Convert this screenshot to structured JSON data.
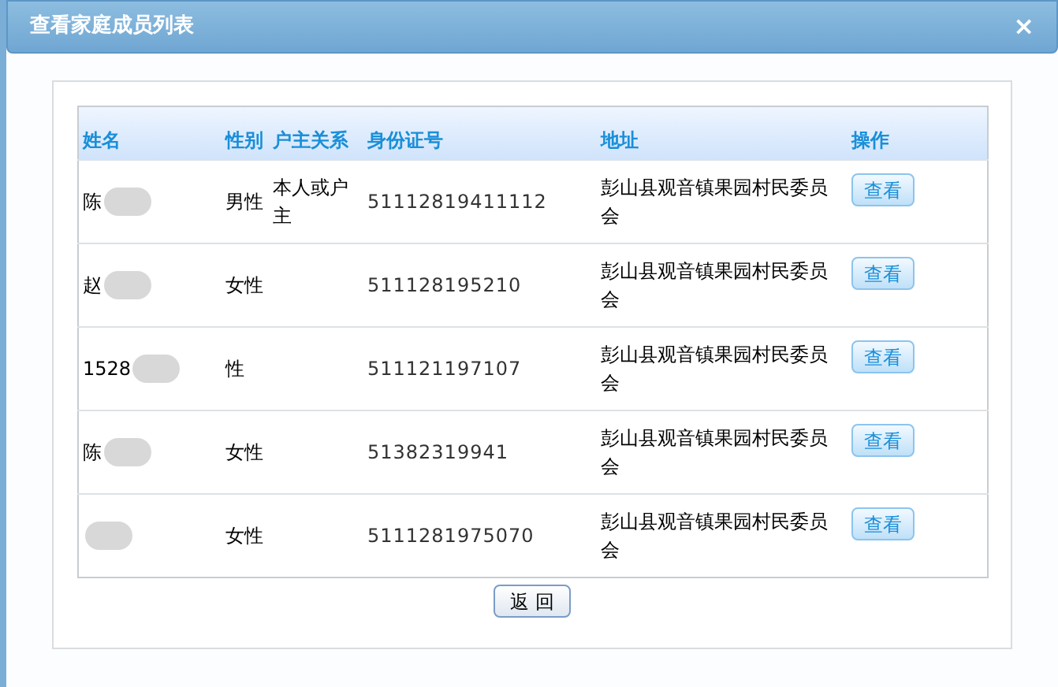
{
  "dialog": {
    "title": "查看家庭成员列表",
    "close": "×"
  },
  "table": {
    "columns": [
      "姓名",
      "性别",
      "户主关系",
      "身份证号",
      "地址",
      "操作"
    ],
    "rows": [
      {
        "name": "陈",
        "gender": "男性",
        "relation": "本人或户主",
        "id_number": "51112819411112",
        "address": "彭山县观音镇果园村民委员会",
        "action": "查看"
      },
      {
        "name": "赵",
        "gender": "女性",
        "id_number": "511128195210",
        "address": "彭山县观音镇果园村民委员会",
        "action": "查看"
      },
      {
        "name": "1528",
        "gender": "性",
        "id_number": "511121197107",
        "address": "彭山县观音镇果园村民委员会",
        "action": "查看"
      },
      {
        "name": "陈",
        "gender": "女性",
        "id_number": "51382319941",
        "address": "彭山县观音镇果园村民委员会",
        "action": "查看"
      },
      {
        "gender": "女性",
        "id_number": "5111281975070",
        "address": "彭山县观音镇果园村民委员会",
        "action": "查看"
      }
    ]
  },
  "return_button": "返 回"
}
